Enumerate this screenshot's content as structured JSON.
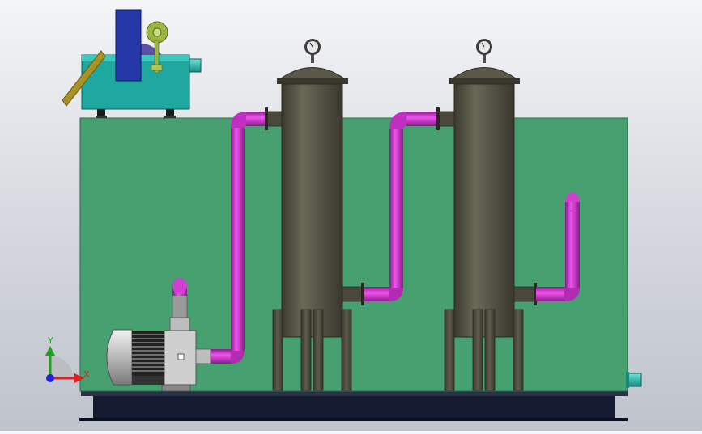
{
  "viewport": {
    "background_top": "#f4f5f7",
    "background_bottom": "#bfc3cb"
  },
  "model": {
    "colors": {
      "skid_panel": "#46a06f",
      "base_frame": "#141a30",
      "compressor_body": "#1fa8a0",
      "compressor_tank": "#2638a8",
      "vessel": "#545244",
      "pipe": "#cc22cc",
      "motor": "#d4d4d4"
    },
    "components": [
      "air-compressor",
      "pressure-gauge",
      "filter-vessel",
      "centrifugal-pump",
      "electric-motor",
      "piping"
    ]
  },
  "triad": {
    "x_label": "X",
    "y_label": "Y",
    "x_color": "#e02020",
    "y_color": "#20a020",
    "z_color": "#2020e0"
  }
}
